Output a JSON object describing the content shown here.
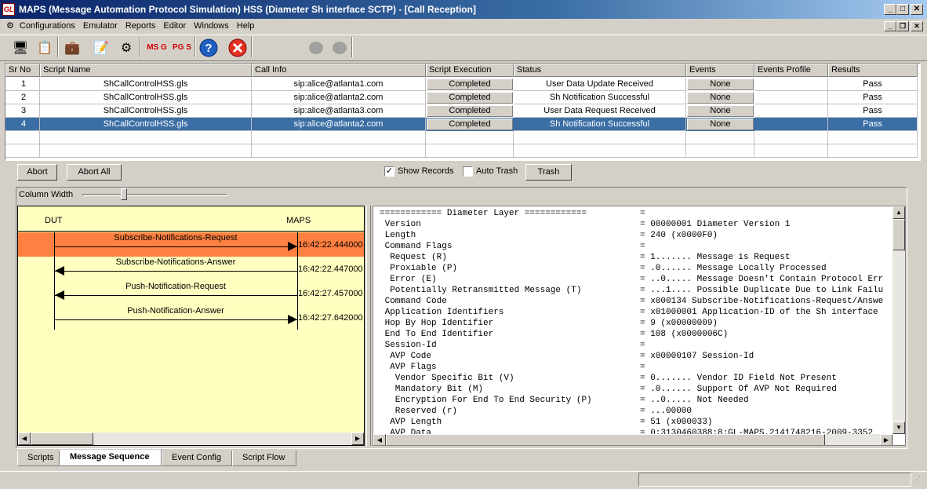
{
  "window": {
    "title": "MAPS (Message Automation Protocol Simulation) HSS (Diameter Sh interface SCTP) - [Call Reception]",
    "icon_text": "GL"
  },
  "menu": [
    "Configurations",
    "Emulator",
    "Reports",
    "Editor",
    "Windows",
    "Help"
  ],
  "toolbar": {
    "icons": [
      "monitor-icon",
      "notepad-icon",
      "briefcase-icon",
      "script-editor-icon",
      "gears-icon",
      "msg-icon",
      "pgs-icon",
      "help-icon",
      "stop-icon",
      "circle-icon",
      "circle-icon"
    ],
    "msg_label": "MS G",
    "pgs_label": "PG S"
  },
  "grid": {
    "columns": [
      "Sr No",
      "Script Name",
      "Call Info",
      "Script Execution",
      "Status",
      "Events",
      "Events Profile",
      "Results"
    ],
    "rows": [
      {
        "sr": "1",
        "script": "ShCallControlHSS.gls",
        "call": "sip:alice@atlanta1.com",
        "exec": "Completed",
        "status": "User Data Update Received",
        "events": "None",
        "profile": "",
        "result": "Pass"
      },
      {
        "sr": "2",
        "script": "ShCallControlHSS.gls",
        "call": "sip:alice@atlanta2.com",
        "exec": "Completed",
        "status": "Sh Notification Successful",
        "events": "None",
        "profile": "",
        "result": "Pass"
      },
      {
        "sr": "3",
        "script": "ShCallControlHSS.gls",
        "call": "sip:alice@atlanta3.com",
        "exec": "Completed",
        "status": "User Data Request Received",
        "events": "None",
        "profile": "",
        "result": "Pass"
      },
      {
        "sr": "4",
        "script": "ShCallControlHSS.gls",
        "call": "sip:alice@atlanta2.com",
        "exec": "Completed",
        "status": "Sh Notification Successful",
        "events": "None",
        "profile": "",
        "result": "Pass"
      }
    ],
    "selected_row": 3
  },
  "controls": {
    "abort": "Abort",
    "abort_all": "Abort All",
    "show_records": "Show Records",
    "show_records_checked": true,
    "auto_trash": "Auto Trash",
    "auto_trash_checked": false,
    "trash": "Trash",
    "column_width": "Column Width"
  },
  "sequence": {
    "left_label": "DUT",
    "right_label": "MAPS",
    "messages": [
      {
        "name": "Subscribe-Notifications-Request",
        "time": "16:42:22.444000",
        "direction": "right",
        "highlighted": true
      },
      {
        "name": "Subscribe-Notifications-Answer",
        "time": "16:42:22.447000",
        "direction": "left",
        "highlighted": false
      },
      {
        "name": "Push-Notification-Request",
        "time": "16:42:27.457000",
        "direction": "left",
        "highlighted": false
      },
      {
        "name": "Push-Notification-Answer",
        "time": "16:42:27.642000",
        "direction": "right",
        "highlighted": false
      }
    ]
  },
  "decode": [
    {
      "field": "============ Diameter Layer ============",
      "value": "="
    },
    {
      "field": " Version",
      "value": "= 00000001 Diameter Version 1"
    },
    {
      "field": " Length",
      "value": "= 240 (x0000F0)"
    },
    {
      "field": " Command Flags",
      "value": "="
    },
    {
      "field": "  Request (R)",
      "value": "= 1....... Message is Request"
    },
    {
      "field": "  Proxiable (P)",
      "value": "= .0...... Message Locally Processed"
    },
    {
      "field": "  Error (E)",
      "value": "= ..0..... Message Doesn't Contain Protocol Err"
    },
    {
      "field": "  Potentially Retransmitted Message (T)",
      "value": "= ...1.... Possible Duplicate Due to Link Failu"
    },
    {
      "field": " Command Code",
      "value": "= x000134 Subscribe-Notifications-Request/Answe"
    },
    {
      "field": " Application Identifiers",
      "value": "= x01000001 Application-ID of the Sh interface"
    },
    {
      "field": " Hop By Hop Identifier",
      "value": "= 9 (x00000009)"
    },
    {
      "field": " End To End Identifier",
      "value": "= 108 (x0000006C)"
    },
    {
      "field": " Session-Id",
      "value": "="
    },
    {
      "field": "  AVP Code",
      "value": "= x00000107 Session-Id"
    },
    {
      "field": "  AVP Flags",
      "value": "="
    },
    {
      "field": "   Vendor Specific Bit (V)",
      "value": "= 0....... Vendor ID Field Not Present"
    },
    {
      "field": "   Mandatory Bit (M)",
      "value": "= .0...... Support Of AVP Not Required"
    },
    {
      "field": "   Encryption For End To End Security (P)",
      "value": "= ..0..... Not Needed"
    },
    {
      "field": "   Reserved (r)",
      "value": "= ...00000"
    },
    {
      "field": "  AVP Length",
      "value": "= 51 (x000033)"
    },
    {
      "field": "  AVP Data",
      "value": "= 0;3130460388;8;GL-MAPS.2141748216-2009-3352"
    }
  ],
  "tabs": [
    {
      "label": "Scripts",
      "active": false
    },
    {
      "label": "Message Sequence",
      "active": true
    },
    {
      "label": "Event Config",
      "active": false
    },
    {
      "label": "Script Flow",
      "active": false
    }
  ],
  "colors": {
    "title_start": "#0a246a",
    "selected_row": "#3a6ea5",
    "highlight_message": "#ff8040",
    "sequence_bg": "#ffffc0",
    "stop_red": "#e03020",
    "help_blue": "#2060c0"
  }
}
